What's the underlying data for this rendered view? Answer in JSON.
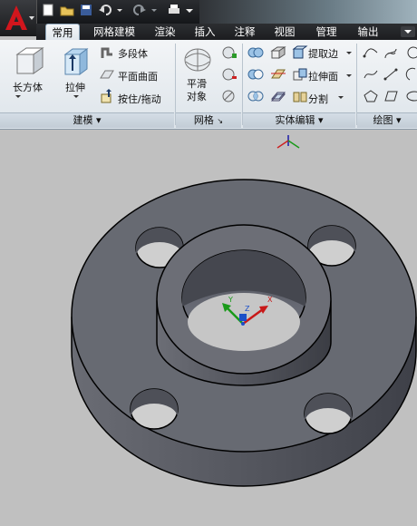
{
  "app": {
    "logo_letter": "A",
    "accent": "#c8151b"
  },
  "tabs": [
    "常用",
    "网格建模",
    "渲染",
    "插入",
    "注释",
    "视图",
    "管理",
    "输出"
  ],
  "ribbon": {
    "modeling": {
      "title": "建模",
      "box_label": "长方体",
      "extrude_label": "拉伸",
      "polysolid_label": "多段体",
      "planar_label": "平面曲面",
      "presspull_label": "按住/拖动"
    },
    "mesh": {
      "title": "网格",
      "smooth_label": "平滑\n对象"
    },
    "solid_edit": {
      "title": "实体编辑",
      "extract_label": "提取边",
      "extrude_face_label": "拉伸面",
      "separate_label": "分割"
    },
    "draw": {
      "title": "绘图"
    }
  },
  "ucs": {
    "x": "X",
    "y": "Y",
    "z": "Z"
  }
}
